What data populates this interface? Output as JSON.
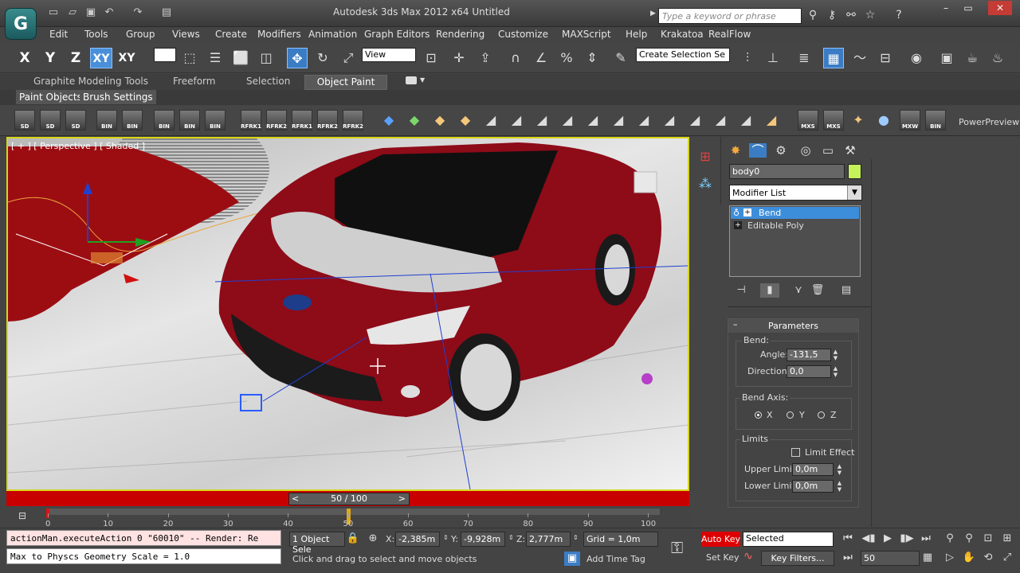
{
  "window": {
    "title": "Autodesk 3ds Max  2012 x64      Untitled",
    "search_placeholder": "Type a keyword or phrase",
    "minimize": "–",
    "restore": "▭",
    "close": "✕"
  },
  "menu": [
    "Edit",
    "Tools",
    "Group",
    "Views",
    "Create",
    "Modifiers",
    "Animation",
    "Graph Editors",
    "Rendering",
    "Customize",
    "MAXScript",
    "Help",
    "Krakatoa",
    "RealFlow"
  ],
  "toolbar": {
    "axis": [
      "X",
      "Y",
      "Z",
      "XY",
      "XY"
    ],
    "ref_coord": "View",
    "named_selection": "Create Selection Se"
  },
  "ribbon": {
    "tabs": [
      "Graphite Modeling Tools",
      "Freeform",
      "Selection",
      "Object Paint"
    ],
    "active_tab": "Object Paint",
    "sub_tabs": [
      "Paint Objects",
      "Brush Settings"
    ]
  },
  "brushbar": {
    "icons": [
      "SD",
      "SD",
      "SD",
      "BIN",
      "BIN",
      "BIN",
      "BIN",
      "BIN",
      "RFRK1",
      "RFRK2",
      "RFRK1",
      "RFRK2",
      "RFRK2",
      "MXS",
      "MXS",
      "MXW",
      "BIN"
    ],
    "power_preview": "PowerPreview"
  },
  "viewport": {
    "label": "[ + ] [ Perspective ] [ Shaded ]"
  },
  "command_panel": {
    "object_name": "body0",
    "object_color": "#c6f25a",
    "modifier_list": "Modifier List",
    "stack": [
      "Bend",
      "Editable Poly"
    ],
    "selected_modifier": "Bend"
  },
  "parameters": {
    "title": "Parameters",
    "bend_group": "Bend:",
    "angle_label": "Angle:",
    "angle_value": "-131,5",
    "direction_label": "Direction:",
    "direction_value": "0,0",
    "bend_axis_group": "Bend Axis:",
    "axes": [
      "X",
      "Y",
      "Z"
    ],
    "selected_axis": "X",
    "limits_group": "Limits",
    "limit_effect": "Limit Effect",
    "upper_label": "Upper Limit:",
    "upper_value": "0,0m",
    "lower_label": "Lower Limit:",
    "lower_value": "0,0m"
  },
  "timeline": {
    "slider": "50 / 100",
    "current_frame": 50,
    "total_frames": 100,
    "ticks": [
      "0",
      "10",
      "20",
      "30",
      "40",
      "50",
      "60",
      "70",
      "80",
      "90",
      "100"
    ]
  },
  "status": {
    "maxscript_1": "actionMan.executeAction 0 \"60010\"  -- Render: Re",
    "maxscript_2": "Max to Physcs Geometry Scale = 1.0",
    "selection": "1 Object Sele",
    "x_label": "X:",
    "x_value": "-2,385m",
    "y_label": "Y:",
    "y_value": "-9,928m",
    "z_label": "Z:",
    "z_value": "2,777m",
    "grid": "Grid = 1,0m",
    "prompt": "Click and drag to select and move objects",
    "add_time_tag": "Add Time Tag",
    "auto_key": "Auto Key",
    "key_mode": "Selected",
    "set_key": "Set Key",
    "key_filters": "Key Filters...",
    "frame": "50"
  }
}
